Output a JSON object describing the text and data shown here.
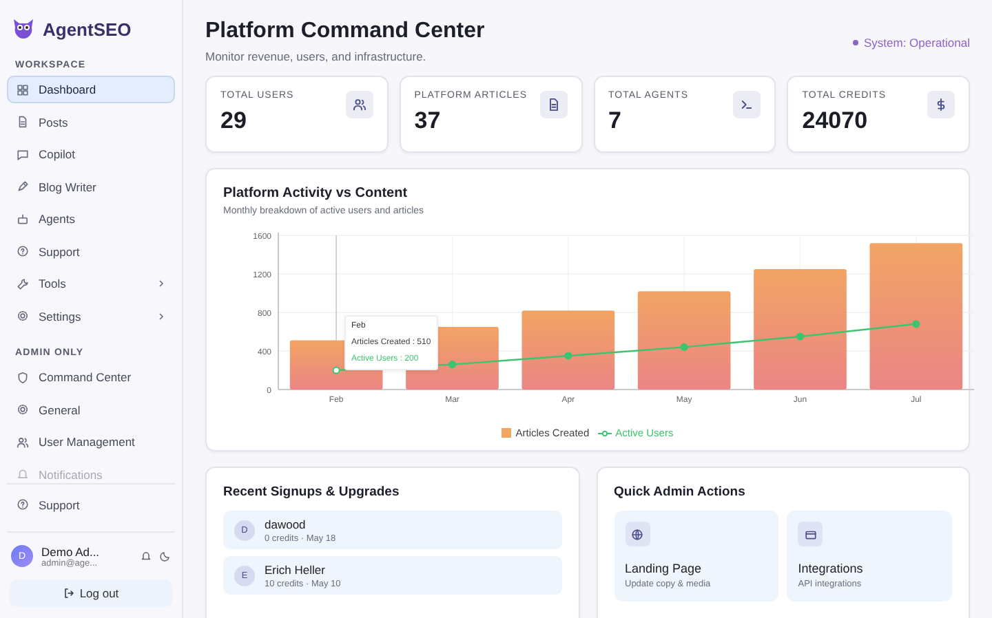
{
  "brand": {
    "name": "AgentSEO"
  },
  "sidebar": {
    "sections": [
      {
        "heading": "WORKSPACE",
        "items": [
          {
            "label": "Dashboard",
            "selected": true,
            "expandable": false
          },
          {
            "label": "Posts",
            "selected": false,
            "expandable": false
          },
          {
            "label": "Copilot",
            "selected": false,
            "expandable": false
          },
          {
            "label": "Blog Writer",
            "selected": false,
            "expandable": false
          },
          {
            "label": "Agents",
            "selected": false,
            "expandable": false
          },
          {
            "label": "Support",
            "selected": false,
            "expandable": false
          },
          {
            "label": "Tools",
            "selected": false,
            "expandable": true
          },
          {
            "label": "Settings",
            "selected": false,
            "expandable": true
          }
        ]
      },
      {
        "heading": "ADMIN ONLY",
        "items": [
          {
            "label": "Command Center",
            "selected": false,
            "expandable": false
          },
          {
            "label": "General",
            "selected": false,
            "expandable": false
          },
          {
            "label": "User Management",
            "selected": false,
            "expandable": false
          },
          {
            "label": "Notifications",
            "selected": false,
            "expandable": false
          }
        ]
      }
    ],
    "footer_item": {
      "label": "Support"
    },
    "user": {
      "initial": "D",
      "name": "Demo Ad...",
      "email": "admin@age..."
    },
    "logout": "Log out"
  },
  "header": {
    "title": "Platform Command Center",
    "subtitle": "Monitor revenue, users, and infrastructure.",
    "status": "System: Operational"
  },
  "stats": [
    {
      "label": "TOTAL USERS",
      "value": "29"
    },
    {
      "label": "PLATFORM ARTICLES",
      "value": "37"
    },
    {
      "label": "TOTAL AGENTS",
      "value": "7"
    },
    {
      "label": "TOTAL CREDITS",
      "value": "24070"
    }
  ],
  "activity": {
    "title": "Platform Activity vs Content",
    "subtitle": "Monthly breakdown of active users and articles",
    "chart_data": {
      "type": "bar",
      "categories": [
        "Feb",
        "Mar",
        "Apr",
        "May",
        "Jun",
        "Jul"
      ],
      "series": [
        {
          "name": "Articles Created",
          "type": "bar",
          "color": "#f2a463",
          "values": [
            510,
            650,
            820,
            1020,
            1250,
            1520
          ]
        },
        {
          "name": "Active Users",
          "type": "line",
          "marker": "circle",
          "color": "#3cc46e",
          "values": [
            200,
            260,
            350,
            440,
            550,
            680
          ]
        }
      ],
      "ref_lines": [
        {
          "axis": "x",
          "value": "Feb"
        }
      ],
      "stacked": false,
      "grid": true,
      "legend": "bottom",
      "ylim": [
        0,
        1600
      ],
      "yticks": [
        0,
        400,
        800,
        1200,
        1600
      ]
    },
    "tooltip": {
      "title": "Feb",
      "lines": [
        "Articles Created : 510",
        "Active Users : 200"
      ]
    }
  },
  "signups": {
    "title": "Recent Signups & Upgrades",
    "rows": [
      {
        "initial": "D",
        "name": "dawood",
        "meta": "0 credits · May 18"
      },
      {
        "initial": "E",
        "name": "Erich Heller",
        "meta": "10 credits · May 10"
      }
    ]
  },
  "quick_actions": {
    "title": "Quick Admin Actions",
    "items": [
      {
        "title": "Landing Page",
        "subtitle": "Update copy & media"
      },
      {
        "title": "Integrations",
        "subtitle": "API integrations"
      }
    ]
  }
}
